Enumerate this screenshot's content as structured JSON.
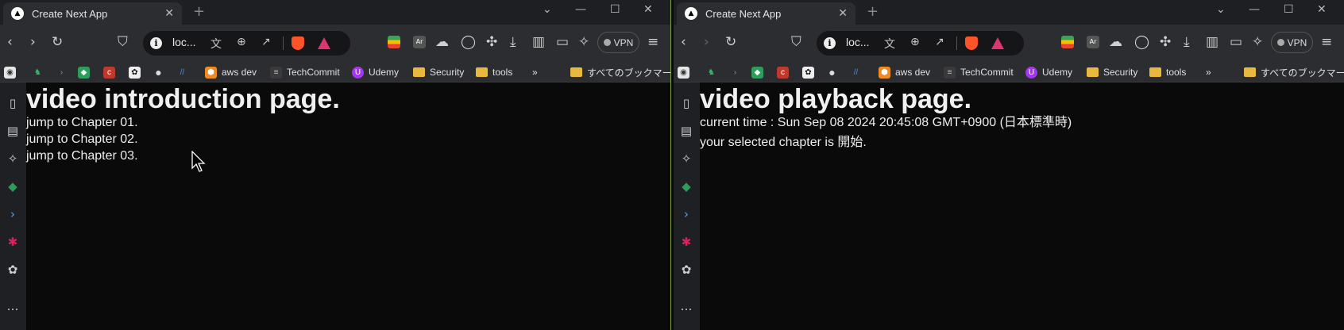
{
  "left": {
    "tab_title": "Create Next App",
    "url": "loc...",
    "vpn_label": "VPN",
    "bookmarks": [
      "aws dev",
      "TechCommit",
      "Udemy",
      "Security",
      "tools"
    ],
    "all_bookmarks": "すべてのブックマーク",
    "heading": "video introduction page.",
    "lines": [
      "jump to Chapter 01.",
      "jump to Chapter 02.",
      "jump to Chapter 03."
    ]
  },
  "right": {
    "tab_title": "Create Next App",
    "url": "loc...",
    "vpn_label": "VPN",
    "bookmarks": [
      "aws dev",
      "TechCommit",
      "Udemy",
      "Security",
      "tools"
    ],
    "all_bookmarks": "すべてのブックマーク",
    "heading": "video playback page.",
    "current_time": "current time : Sun Sep 08 2024 20:45:08 GMT+0900 (日本標準時)",
    "selected_chapter": "your selected chapter is 開始."
  },
  "colors": {
    "accent_divider": "#7ea63a",
    "brave_orange": "#fb542b",
    "bookmark_folder": "#e8b93d",
    "page_bg": "#0a0a0a"
  },
  "icons": {
    "tab": "nextjs-logo-icon",
    "nav": [
      "back-icon",
      "forward-icon",
      "reload-icon",
      "bookmark-page-icon"
    ],
    "omnibox": [
      "site-info-icon",
      "translate-icon",
      "zoom-icon",
      "share-icon",
      "brave-shields-icon",
      "brave-rewards-icon"
    ],
    "extensions": [
      "google-colors-extension-icon",
      "ar-extension-icon",
      "cloud-extension-icon",
      "circle-extension-icon",
      "puzzle-extensions-icon",
      "download-icon",
      "sidebar-toggle-icon",
      "wallet-icon",
      "leo-ai-icon",
      "vpn-icon",
      "menu-icon"
    ],
    "sidebar": [
      "bookmarks-panel-icon",
      "reading-list-icon",
      "leo-icon",
      "diamond-green-icon",
      "terminal-icon",
      "slack-icon",
      "chatgpt-icon",
      "more-icon"
    ]
  }
}
